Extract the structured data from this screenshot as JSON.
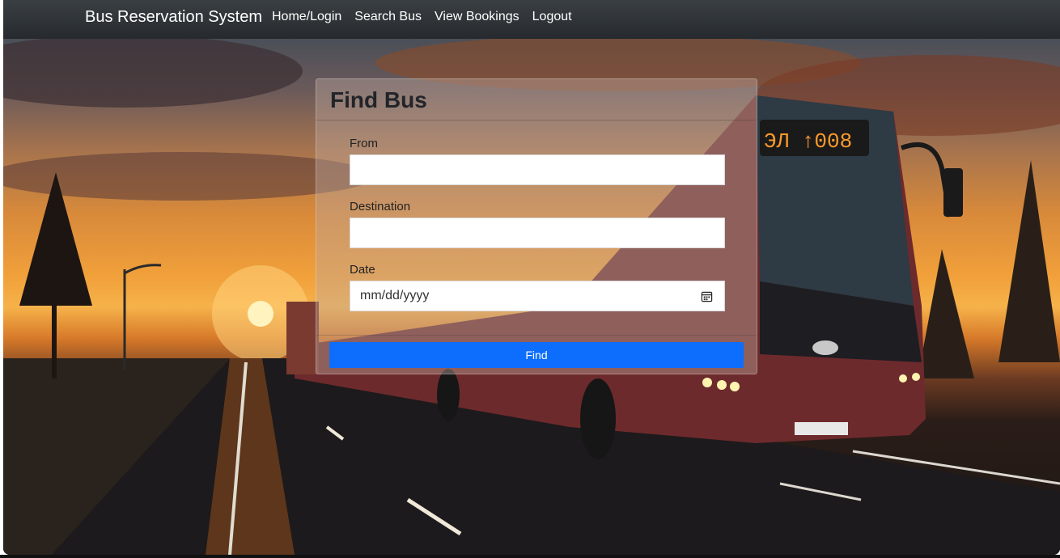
{
  "navbar": {
    "brand": "Bus Reservation System",
    "links": [
      "Home/Login",
      "Search Bus",
      "View Bookings",
      "Logout"
    ]
  },
  "form": {
    "title": "Find Bus",
    "from_label": "From",
    "from_value": "",
    "destination_label": "Destination",
    "destination_value": "",
    "date_label": "Date",
    "date_placeholder": "mm/dd/yyyy",
    "submit_label": "Find"
  },
  "colors": {
    "navbar": "#2c3034",
    "primary_button": "#0d6efd"
  },
  "icons": [
    "calendar-icon"
  ]
}
